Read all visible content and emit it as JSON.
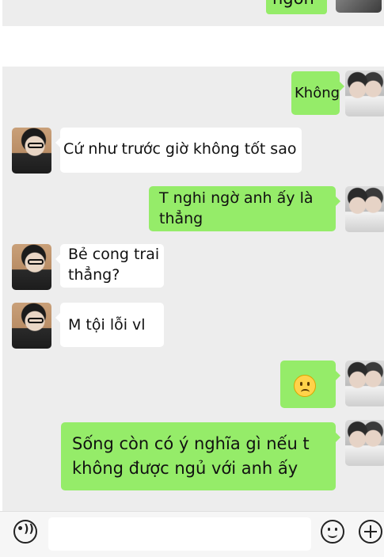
{
  "top_fragment": {
    "text": "ngon"
  },
  "messages": [
    {
      "side": "out",
      "text": "Không"
    },
    {
      "side": "in",
      "text": "Cứ như trước giờ không tốt sao"
    },
    {
      "side": "out",
      "lines": [
        "T nghi ngờ anh ấy là",
        "thẳng"
      ]
    },
    {
      "side": "in",
      "lines": [
        "Bẻ cong trai",
        "thẳng?"
      ]
    },
    {
      "side": "in",
      "text": "M tội lỗi vl"
    },
    {
      "side": "out",
      "emoji": "frowning-face"
    },
    {
      "side": "out",
      "lines": [
        "Sống còn có ý nghĩa gì nếu t",
        "không được ngủ với anh ấy"
      ]
    }
  ],
  "input_bar": {
    "voice_label": "•))",
    "message_placeholder": ""
  },
  "colors": {
    "outgoing": "#95ec69",
    "incoming": "#ffffff",
    "background": "#ededed"
  }
}
